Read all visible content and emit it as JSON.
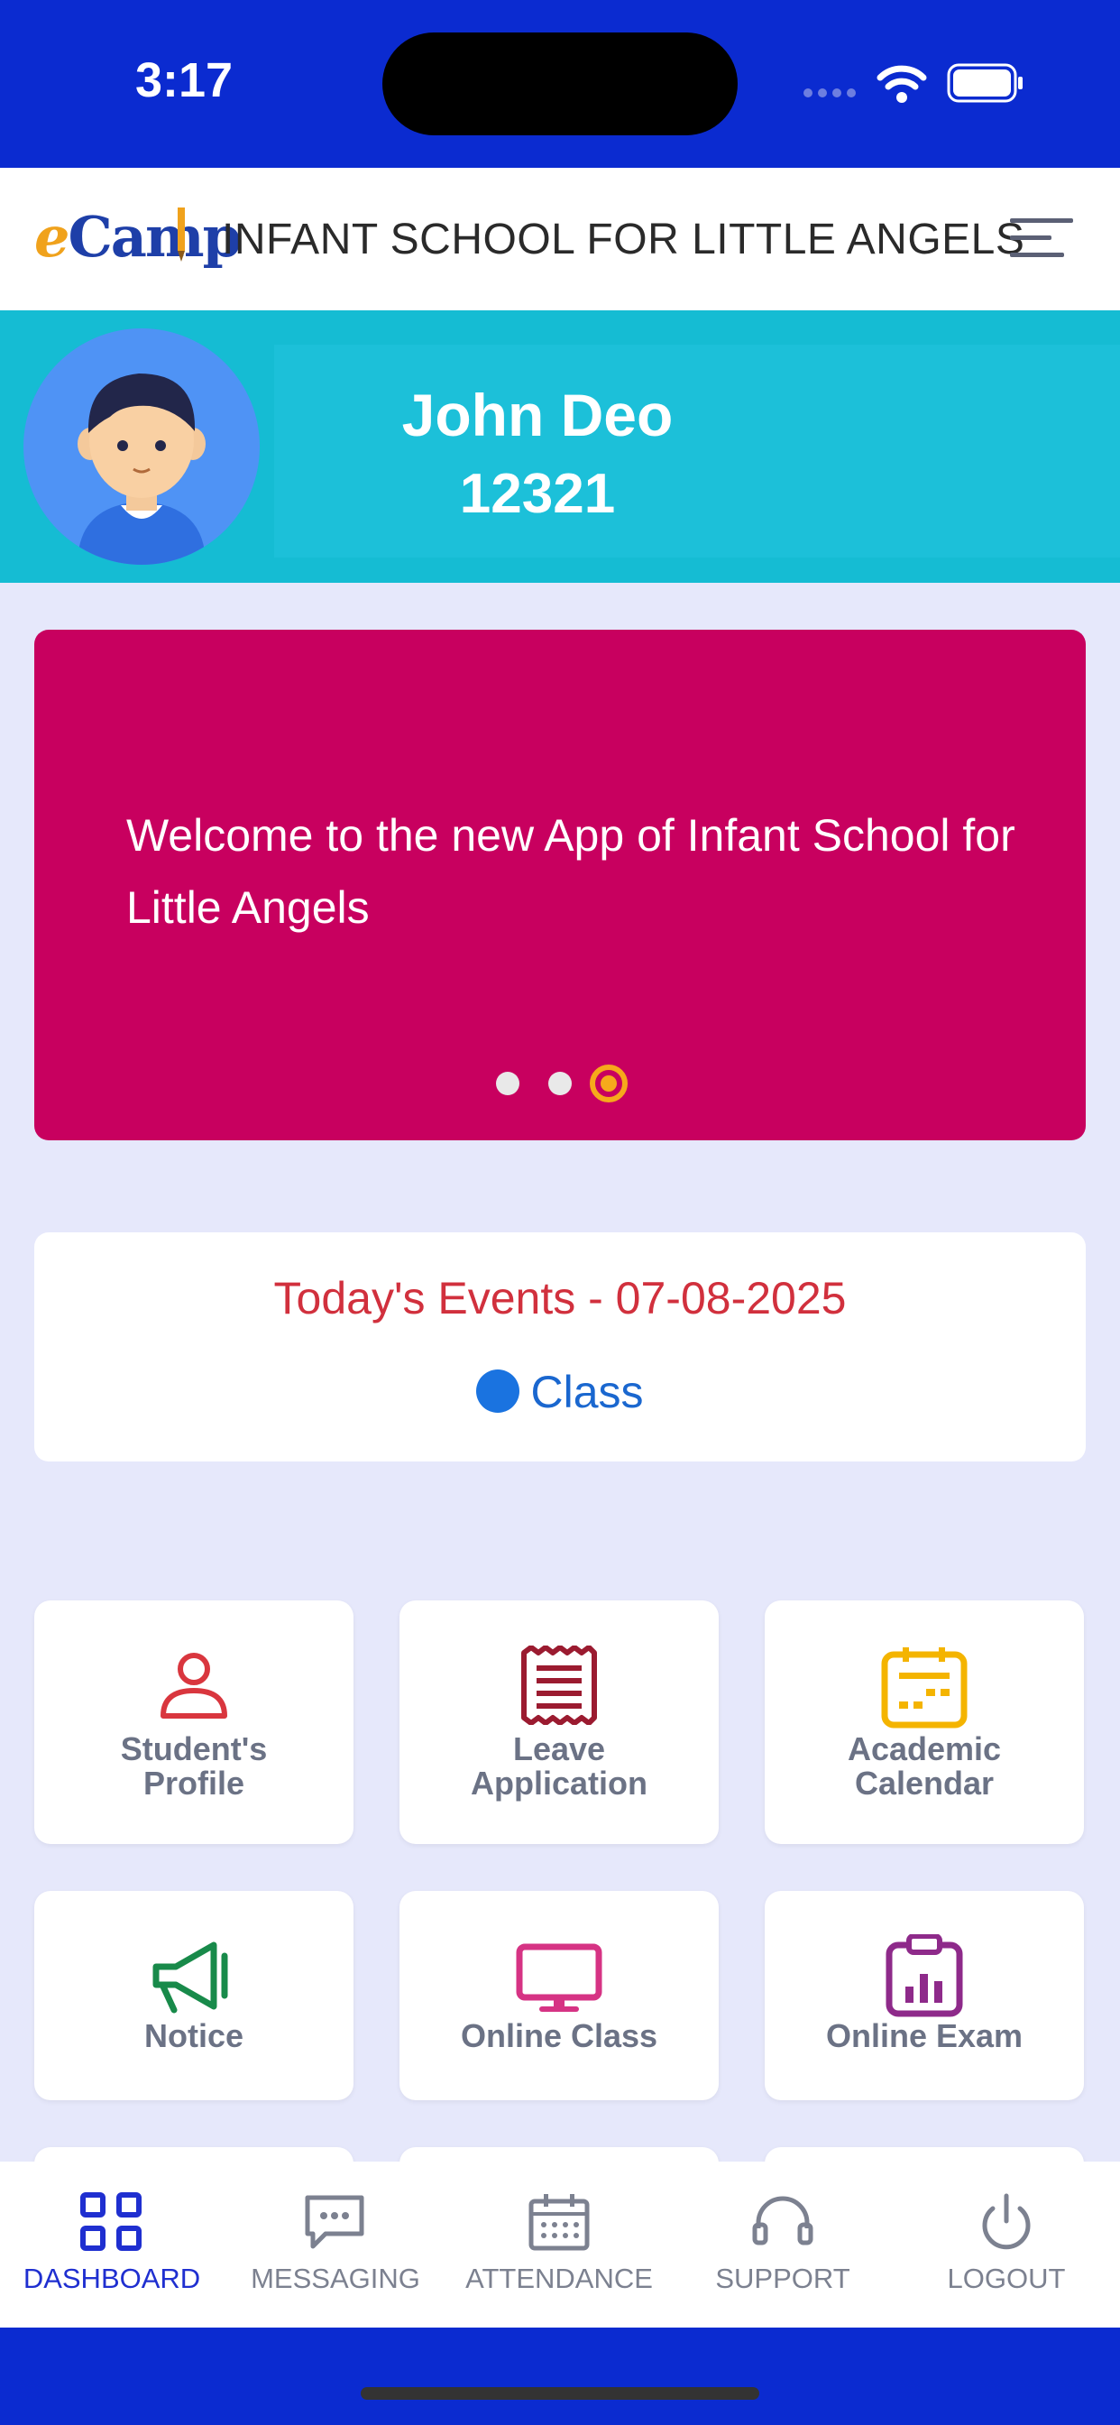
{
  "status_bar": {
    "time": "3:17"
  },
  "header": {
    "logo_e": "e",
    "logo_rest": "Camp",
    "school_name": "INFANT SCHOOL FOR LITTLE ANGELS"
  },
  "profile": {
    "name": "John Deo",
    "id": "12321"
  },
  "carousel": {
    "text": "Welcome to the new App of Infant School for Little Angels",
    "slide_count": 3,
    "active_slide": 3
  },
  "events": {
    "title": "Today's Events - 07-08-2025",
    "items": [
      "Class"
    ]
  },
  "tiles": [
    {
      "label_line1": "Student's",
      "label_line2": "Profile",
      "icon": "user-icon",
      "color": "#d9363e"
    },
    {
      "label_line1": "Leave",
      "label_line2": "Application",
      "icon": "receipt-icon",
      "color": "#9b1b30"
    },
    {
      "label_line1": "Academic",
      "label_line2": "Calendar",
      "icon": "calendar-icon",
      "color": "#f4b400"
    },
    {
      "label_line1": "Notice",
      "icon": "megaphone-icon",
      "color": "#188a4a"
    },
    {
      "label_line1": "Online Class",
      "icon": "monitor-icon",
      "color": "#d63384"
    },
    {
      "label_line1": "Online Exam",
      "icon": "clipboard-chart-icon",
      "color": "#8e2a8a"
    }
  ],
  "nav": [
    {
      "label": "DASHBOARD",
      "icon": "grid-icon",
      "active": true
    },
    {
      "label": "MESSAGING",
      "icon": "message-icon",
      "active": false
    },
    {
      "label": "ATTENDANCE",
      "icon": "calendar-icon",
      "active": false
    },
    {
      "label": "SUPPORT",
      "icon": "headset-icon",
      "active": false
    },
    {
      "label": "LOGOUT",
      "icon": "power-icon",
      "active": false
    }
  ],
  "colors": {
    "brand_blue": "#0b2bd0",
    "banner": "#15bcd3",
    "carousel": "#c8005f",
    "active_nav": "#1f2fd0"
  }
}
